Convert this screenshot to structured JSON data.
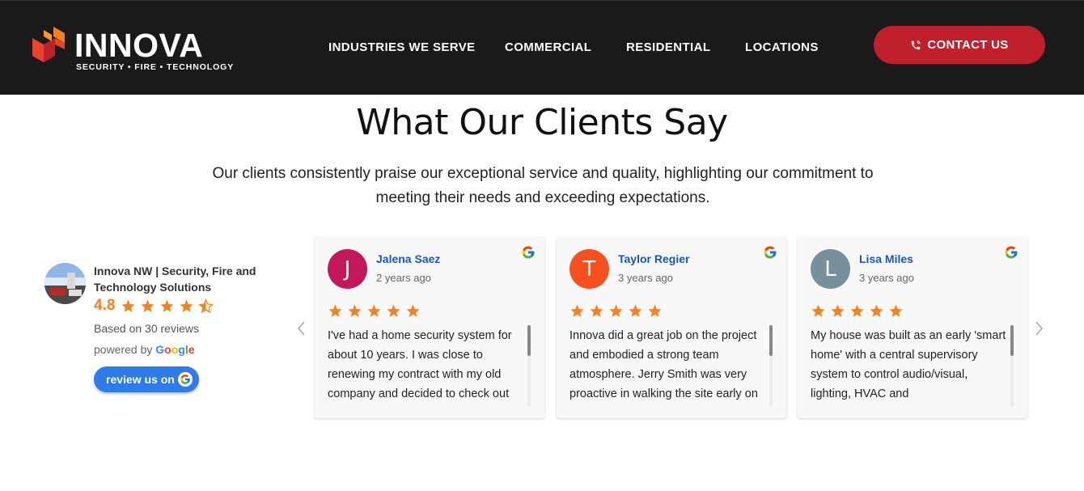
{
  "header": {
    "logo_word": "INNOVA",
    "logo_tagline": "SECURITY • FIRE • TECHNOLOGY",
    "nav": [
      "INDUSTRIES WE SERVE",
      "COMMERCIAL",
      "RESIDENTIAL",
      "LOCATIONS"
    ],
    "contact_label": "CONTACT US",
    "colors": {
      "bar": "#1b1a1a",
      "accent": "#c0202c"
    }
  },
  "section": {
    "title": "What Our Clients Say",
    "subtitle": "Our clients consistently praise our exceptional service and quality, highlighting our commitment to meeting their needs and exceeding expectations."
  },
  "business": {
    "name": "Innova NW | Security, Fire and Technology Solutions",
    "rating": "4.8",
    "stars": 4.5,
    "based_on": "Based on 30 reviews",
    "powered_by": "powered by",
    "google": "Google",
    "review_button": "review us on"
  },
  "reviews": [
    {
      "initial": "J",
      "avatar_color": "#c2185b",
      "name": "Jalena Saez",
      "date": "2 years ago",
      "stars": 5,
      "text": "I've had a home security system for about 10 years. I was close to renewing my contract with my old company and decided to check out"
    },
    {
      "initial": "T",
      "avatar_color": "#f4511e",
      "name": "Taylor Regier",
      "date": "3 years ago",
      "stars": 5,
      "text": "Innova did a great job on the project and embodied a strong team atmosphere. Jerry Smith was very proactive in walking the site early on"
    },
    {
      "initial": "L",
      "avatar_color": "#78909c",
      "name": "Lisa Miles",
      "date": "3 years ago",
      "stars": 5,
      "text": "My house was built as an early 'smart home' with a central supervisory system to control audio/visual, lighting, HVAC and"
    }
  ],
  "icons": {
    "prev": "chevron-left-icon",
    "next": "chevron-right-icon",
    "phone": "phone-icon",
    "google": "google-g-icon",
    "star": "star-icon"
  },
  "star_color": "#f58220"
}
